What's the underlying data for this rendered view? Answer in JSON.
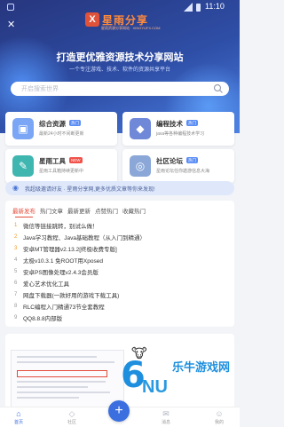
{
  "status": {
    "time": "11:10"
  },
  "brand": {
    "logo_mark": "X",
    "logo_text": "星雨分享",
    "logo_sub": "星雨资源分享网站 · XINGYUFX.COM"
  },
  "hero": {
    "title": "打造更优雅资源技术分享网站",
    "subtitle": "一个专注游戏、技术、软件的资源共享平台"
  },
  "search": {
    "placeholder": "开启搜索世界"
  },
  "cards": [
    {
      "title": "综合资源",
      "badge": "热门",
      "badge_color": "#5b8df5",
      "desc": "最新24小时不间断更新",
      "icon": "package-icon",
      "icon_color": "#7aa6f5",
      "glyph": "▣"
    },
    {
      "title": "编程技术",
      "badge": "热门",
      "badge_color": "#5b8df5",
      "desc": "java等各种编程技术学习",
      "icon": "layers-icon",
      "icon_color": "#6f88d8",
      "glyph": "◆"
    },
    {
      "title": "星雨工具",
      "badge": "NEW",
      "badge_color": "#f0524a",
      "desc": "星雨工具箱持续更新中",
      "icon": "toolbox-icon",
      "icon_color": "#3fb6b0",
      "glyph": "✎"
    },
    {
      "title": "社区论坛",
      "badge": "热门",
      "badge_color": "#5b8df5",
      "desc": "星雨论坛任你遨游信息大海",
      "icon": "forum-icon",
      "icon_color": "#8aa7d8",
      "glyph": "◎"
    }
  ],
  "invite": {
    "text": "我超级邀请好友 · 星雨分享网,更多优质文章等你来发现!"
  },
  "tabs": [
    "最新发布",
    "热门文章",
    "最新更新",
    "点赞热门",
    "收藏热门"
  ],
  "list": [
    {
      "num": "1",
      "title": "微信等链接跳转，别试么做！"
    },
    {
      "num": "2",
      "title": "Java学习教程、Java基础教程（从入门到精通）"
    },
    {
      "num": "3",
      "title": "安卓MT管理器v2.13.2[终极收费专版]"
    },
    {
      "num": "4",
      "title": "太极v10.3.1 免ROOT用Xposed"
    },
    {
      "num": "5",
      "title": "安卓PS图像处理v2.4.3会员版"
    },
    {
      "num": "6",
      "title": "爱心艺术优化工具"
    },
    {
      "num": "7",
      "title": "网盘下载器(一款好用的游戏下载工具)"
    },
    {
      "num": "8",
      "title": "RLC编程入门精通73节全套教程"
    },
    {
      "num": "9",
      "title": "QQ8.8.8内部版"
    }
  ],
  "watermark": {
    "number": "6",
    "letters": "NU",
    "text": "乐牛游戏网"
  },
  "bottom_nav": [
    {
      "label": "首页",
      "icon": "home-icon",
      "glyph": "⌂"
    },
    {
      "label": "社区",
      "icon": "community-icon",
      "glyph": "◇"
    },
    {
      "label": "",
      "icon": "plus-icon",
      "glyph": "+"
    },
    {
      "label": "消息",
      "icon": "message-icon",
      "glyph": "✉"
    },
    {
      "label": "我的",
      "icon": "user-icon",
      "glyph": "☺"
    }
  ]
}
